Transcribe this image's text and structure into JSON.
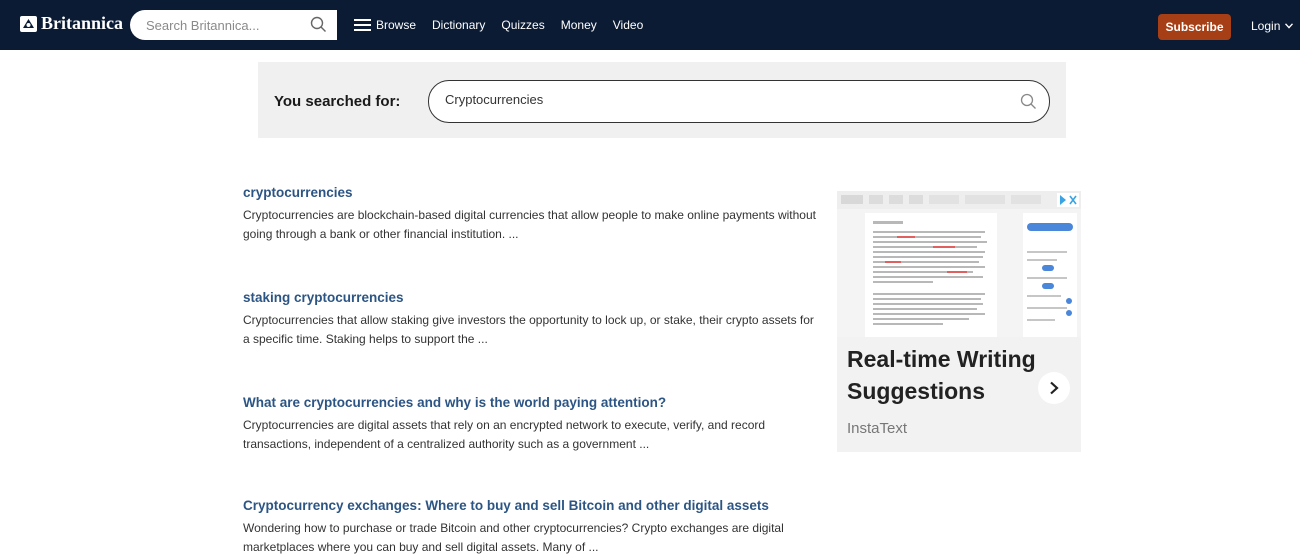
{
  "header": {
    "logo_text": "Britannica",
    "search_placeholder": "Search Britannica...",
    "nav": [
      {
        "label": "Browse"
      },
      {
        "label": "Dictionary"
      },
      {
        "label": "Quizzes"
      },
      {
        "label": "Money"
      },
      {
        "label": "Video"
      }
    ],
    "subscribe_label": "Subscribe",
    "login_label": "Login",
    "colors": {
      "bar": "#0b1b33",
      "subscribe": "#a63f16"
    }
  },
  "search": {
    "label": "You searched for:",
    "query": "Cryptocurrencies"
  },
  "results": [
    {
      "title": "cryptocurrencies",
      "snippet": "Cryptocurrencies are blockchain-based digital currencies that allow people to make online payments without going through a bank or other financial institution. ..."
    },
    {
      "title": "staking cryptocurrencies",
      "snippet": "Cryptocurrencies that allow staking give investors the opportunity to lock up, or stake, their crypto assets for a specific time. Staking helps to support the ..."
    },
    {
      "title": "What are cryptocurrencies and why is the world paying attention?",
      "snippet": "Cryptocurrencies are digital assets that rely on an encrypted network to execute, verify, and record transactions, independent of a centralized authority such as a government ..."
    },
    {
      "title": "Cryptocurrency exchanges: Where to buy and sell Bitcoin and other digital assets",
      "snippet": "Wondering how to purchase or trade Bitcoin and other cryptocurrencies? Crypto exchanges are digital marketplaces where you can buy and sell digital assets. Many of ..."
    }
  ],
  "ad": {
    "headline": "Real-time Writing Suggestions",
    "brand": "InstaText",
    "icons": [
      "ad-choices-icon",
      "chevron-right-icon"
    ]
  }
}
